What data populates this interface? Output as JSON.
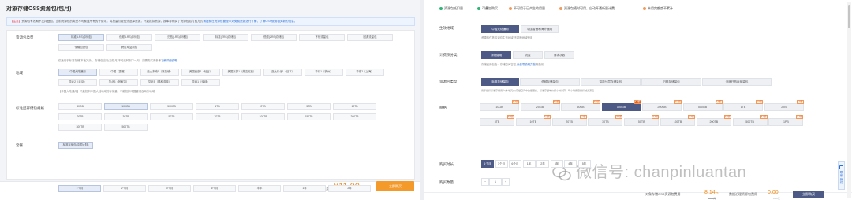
{
  "left": {
    "title": "对象存储OSS资源包(包月)",
    "notice": {
      "tag": "【注意】",
      "text": "资源包有效期不支持叠加，当前资源包的类型不可覆盖所有的计费项，将按量付费优先选择资源，只能抵扣资源，按库存购买了资源包后付费方式",
      "link": "请提前在资源包管理中对免费资源进行了解，了解OSS使用相关新的信息。"
    },
    "resource_type": {
      "label": "资源包类型",
      "options": [
        "标准(LRS)存储包",
        "低频(LRS)存储包",
        "归档(LRS)存储包",
        "标准(ZRS)存储包",
        "低频(ZRS)存储包",
        "下行流量包",
        "回源流量包",
        "传输加速包",
        "跨区域复制包"
      ],
      "note": "【归档(LRS)存储包】仅用于存储标准存储 支付指定存储空间(Bucket)使用单价",
      "note2": "仅适用于标准存储(本地冗余)，存储包当月(自然月)不可结转到下一月，如需购买请参考",
      "note_link": "了解详细说明"
    },
    "region": {
      "label": "地域",
      "options": [
        "中国大陆通用",
        "中国（香港）",
        "亚太东南1（新加坡）",
        "美国西部1（硅谷）",
        "美国东部1（弗吉尼亚）",
        "亚太东北1（日本）",
        "华东1（杭州）",
        "华东2（上海）",
        "华北2（北京）",
        "华北3（张家口）",
        "华北5（呼和浩特）",
        "华南1（深圳）"
      ],
      "note": "【中国大陆通用】只能抵扣中国大陆地域的存储量，不能抵扣中国香港及海外地域"
    },
    "size": {
      "label": "标准型存储包规格",
      "options": [
        "40GB",
        "100GB",
        "500GB",
        "1TB",
        "2TB",
        "5TB",
        "10TB",
        "20TB",
        "30TB",
        "50TB",
        "70TB",
        "100TB",
        "150TB",
        "200TB",
        "300TB",
        "500TB"
      ]
    },
    "package": {
      "label": "套餐",
      "value": "标准存储包(中国大陆)"
    },
    "duration": {
      "label": "购买时长",
      "options": [
        "1个月",
        "2个月",
        "3个月",
        "6个月",
        "半年",
        "1年",
        "2年"
      ]
    },
    "bottom": {
      "price_label": "配置费用",
      "price": "¥11.00",
      "price_unit": "元",
      "buy": "立即购买"
    }
  },
  "right": {
    "checks": [
      {
        "label": "资源包抵扣量",
        "color": "#2bb673"
      },
      {
        "label": "可叠加购买",
        "color": "#2bb673"
      },
      {
        "label": "不可用于已产生的用量",
        "color": "#f29a5a"
      },
      {
        "label": "资源包随时可用，自动开通新量计费",
        "color": "#f29a5a"
      },
      {
        "label": "未用完额度不累计",
        "color": "#f29a5a"
      }
    ],
    "region": {
      "label": "生效地域",
      "options": [
        "中国大陆通用",
        "中国香港和海外通用"
      ],
      "note": "资源包仅抵扣对应生效地域 不能跨地域使用"
    },
    "billing": {
      "label": "计费项分类",
      "options": [
        "存储费用",
        "流量",
        "请求次数"
      ],
      "note": "存储费用包含：存储空间容量,",
      "link": "计费项说明文档",
      "suffix": "请查阅"
    },
    "type": {
      "label": "资源包类型",
      "options": [
        "标准存储量包",
        "低频存储量包",
        "智能分层存储量包",
        "归档存储量包",
        "深度归档存储量包"
      ],
      "note": "用于抵扣标准存储用户(本地冗余)存储空间中的量服务，标准存储单价按小时计算。每小时按容量扣减资源包"
    },
    "size": {
      "label": "规格",
      "row1": [
        "10GB",
        "20GB",
        "50GB",
        "100GB",
        "200GB",
        "500GB",
        "1TB",
        "2TB"
      ],
      "row2": [
        "5TB",
        "10TB",
        "20TB",
        "30TB",
        "50TB",
        "100TB",
        "200TB",
        "500TB",
        "1PB"
      ],
      "badges1": [
        "5.7折",
        "5.4折",
        "5.2折",
        "6.4折",
        "6.2折",
        "6.1折",
        "6.0折",
        "6.0折"
      ],
      "badges2": [
        "5.4折",
        "5.4折",
        "6.4折",
        "6.4折",
        "6.4折",
        "6.3折",
        "6.3折",
        "6.0折",
        "6.0折"
      ]
    },
    "duration": {
      "label": "购买时长",
      "options": [
        "1个月",
        "3个月",
        "6个月",
        "1年",
        "2年",
        "3年",
        "4年",
        "5年"
      ]
    },
    "quantity": {
      "label": "购买数量",
      "minus": "−",
      "value": "1",
      "plus": "+"
    },
    "bottom": {
      "item_label": "对象存储OSS资源包费用",
      "price": "8.14",
      "unit": "元",
      "orig": "11.60元",
      "item2": "数据治理资源包费用",
      "price2": "0.00",
      "orig2": "0.00元",
      "buy": "立即购买"
    }
  },
  "sidebar": {
    "label": "联系我们"
  },
  "watermark": "微信号: chanpinluantan"
}
